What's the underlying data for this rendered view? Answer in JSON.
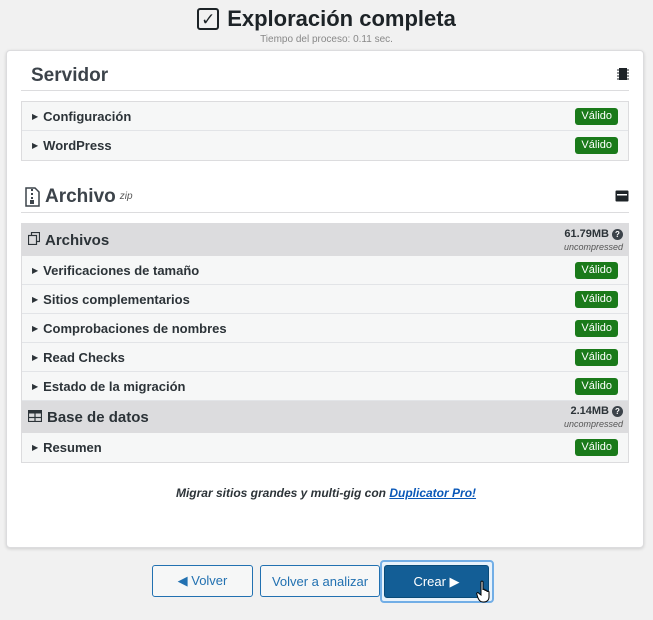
{
  "header": {
    "title": "Exploración completa",
    "subtitle": "Tiempo del proceso: 0.11 sec."
  },
  "server": {
    "title": "Servidor",
    "rows": [
      {
        "label": "Configuración",
        "status": "Válido"
      },
      {
        "label": "WordPress",
        "status": "Válido"
      }
    ]
  },
  "archive": {
    "title": "Archivo",
    "badge_sup": "zip",
    "files": {
      "title": "Archivos",
      "size": "61.79MB",
      "size_note": "uncompressed",
      "rows": [
        {
          "label": "Verificaciones de tamaño",
          "status": "Válido"
        },
        {
          "label": "Sitios complementarios",
          "status": "Válido"
        },
        {
          "label": "Comprobaciones de nombres",
          "status": "Válido"
        },
        {
          "label": "Read Checks",
          "status": "Válido"
        },
        {
          "label": "Estado de la migración",
          "status": "Válido"
        }
      ]
    },
    "database": {
      "title": "Base de datos",
      "size": "2.14MB",
      "size_note": "uncompressed",
      "rows": [
        {
          "label": "Resumen",
          "status": "Válido"
        }
      ]
    }
  },
  "promo": {
    "text": "Migrar sitios grandes y multi-gig con ",
    "link": "Duplicator Pro!"
  },
  "buttons": {
    "back": "◀ Volver",
    "rescan": "Volver a analizar",
    "create": "Crear ▶"
  },
  "colors": {
    "valid_badge": "#1a7a1a",
    "primary": "#135e96",
    "link": "#2271b1"
  }
}
